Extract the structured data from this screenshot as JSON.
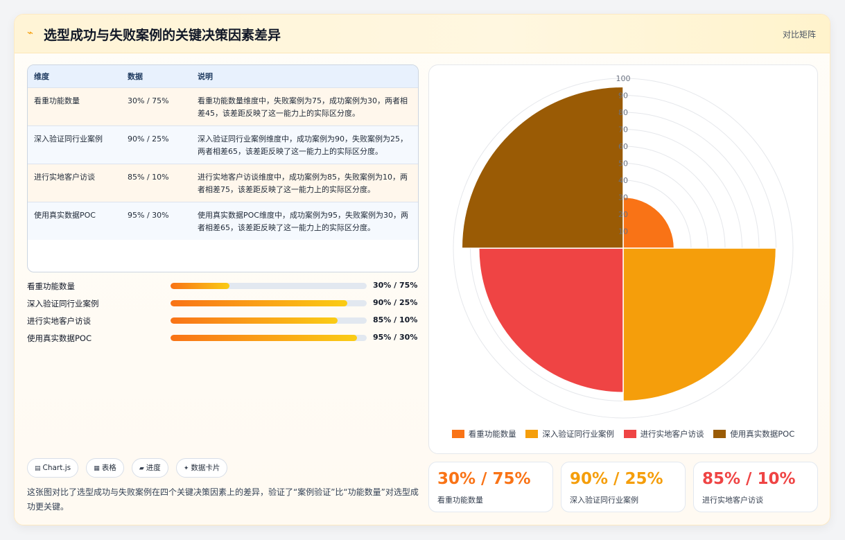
{
  "header": {
    "logo": "⌁",
    "title": "选型成功与失败案例的关键决策因素差异",
    "tag": "对比矩阵"
  },
  "table": {
    "columns": [
      "维度",
      "数据",
      "说明"
    ],
    "rows": [
      {
        "dimension": "看重功能数量",
        "data": "30% / 75%",
        "note": "看重功能数量维度中，失败案例为75，成功案例为30，两者相差45，该差距反映了这一能力上的实际区分度。"
      },
      {
        "dimension": "深入验证同行业案例",
        "data": "90% / 25%",
        "note": "深入验证同行业案例维度中，成功案例为90，失败案例为25，两者相差65，该差距反映了这一能力上的实际区分度。"
      },
      {
        "dimension": "进行实地客户访谈",
        "data": "85% / 10%",
        "note": "进行实地客户访谈维度中，成功案例为85，失败案例为10，两者相差75，该差距反映了这一能力上的实际区分度。"
      },
      {
        "dimension": "使用真实数据POC",
        "data": "95% / 30%",
        "note": "使用真实数据POC维度中，成功案例为95，失败案例为30，两者相差65，该差距反映了这一能力上的实际区分度。"
      }
    ]
  },
  "bars": [
    {
      "label": "看重功能数量",
      "value_text": "30% / 75%",
      "fill": 0.3
    },
    {
      "label": "深入验证同行业案例",
      "value_text": "90% / 25%",
      "fill": 0.9
    },
    {
      "label": "进行实地客户访谈",
      "value_text": "85% / 10%",
      "fill": 0.85
    },
    {
      "label": "使用真实数据POC",
      "value_text": "95% / 30%",
      "fill": 0.95
    }
  ],
  "chips": [
    {
      "icon": "▤",
      "label": "Chart.js"
    },
    {
      "icon": "▦",
      "label": "表格"
    },
    {
      "icon": "▰",
      "label": "进度"
    },
    {
      "icon": "✦",
      "label": "数据卡片"
    }
  ],
  "summary": "这张图对比了选型成功与失败案例在四个关键决策因素上的差异，验证了“案例验证”比“功能数量”对选型成功更关键。",
  "chart_data": {
    "type": "polarArea",
    "categories": [
      "看重功能数量",
      "深入验证同行业案例",
      "进行实地客户访谈",
      "使用真实数据POC"
    ],
    "values": [
      30,
      90,
      85,
      95
    ],
    "colors": [
      "#f97316",
      "#f59e0b",
      "#ef4444",
      "#9a5b05"
    ],
    "rlim": [
      0,
      100
    ],
    "ticks": [
      10,
      20,
      30,
      40,
      50,
      60,
      70,
      80,
      90,
      100
    ],
    "grid": true,
    "legend": "bottom"
  },
  "stats": [
    {
      "value": "30% / 75%",
      "label": "看重功能数量",
      "color": "#f97316"
    },
    {
      "value": "90% / 25%",
      "label": "深入验证同行业案例",
      "color": "#f59e0b"
    },
    {
      "value": "85% / 10%",
      "label": "进行实地客户访谈",
      "color": "#ef4444"
    }
  ]
}
